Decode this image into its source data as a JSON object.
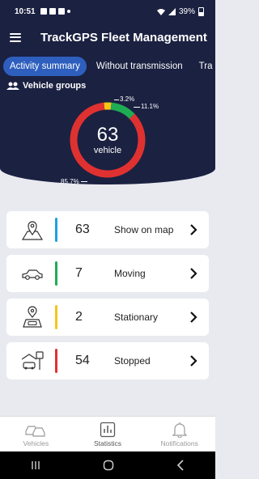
{
  "status_bar": {
    "time": "10:51",
    "battery": "39%"
  },
  "app_bar": {
    "title": "TrackGPS Fleet Management",
    "menu_icon": "hamburger-menu-icon"
  },
  "tabs": [
    {
      "label": "Activity summary",
      "active": true
    },
    {
      "label": "Without transmission",
      "active": false
    },
    {
      "label": "Tra",
      "active": false
    }
  ],
  "vehicle_groups": {
    "label": "Vehicle groups",
    "icon": "people-icon"
  },
  "donut": {
    "total": "63",
    "unit": "vehicle",
    "labels": {
      "yellow": "3.2%",
      "green": "11.1%",
      "red": "85.7%"
    }
  },
  "chart_data": {
    "type": "pie",
    "categories": [
      "Moving",
      "Stationary",
      "Stopped"
    ],
    "values": [
      7,
      2,
      54
    ],
    "percent_labels": [
      "11.1%",
      "3.2%",
      "85.7%"
    ],
    "colors": [
      "#1fad54",
      "#f5c518",
      "#e03131"
    ]
  },
  "cards": [
    {
      "count": "63",
      "label": "Show on map",
      "color": "#1ea1e0",
      "icon": "map-pin-icon"
    },
    {
      "count": "7",
      "label": "Moving",
      "color": "#1fad54",
      "icon": "car-icon"
    },
    {
      "count": "2",
      "label": "Stationary",
      "color": "#f5c518",
      "icon": "location-car-icon"
    },
    {
      "count": "54",
      "label": "Stopped",
      "color": "#e03131",
      "icon": "garage-icon"
    }
  ],
  "bottom_nav": [
    {
      "label": "Vehicles",
      "icon": "vehicles-icon",
      "active": false
    },
    {
      "label": "Statistics",
      "icon": "statistics-icon",
      "active": true
    },
    {
      "label": "Notifications",
      "icon": "bell-icon",
      "active": false
    }
  ]
}
